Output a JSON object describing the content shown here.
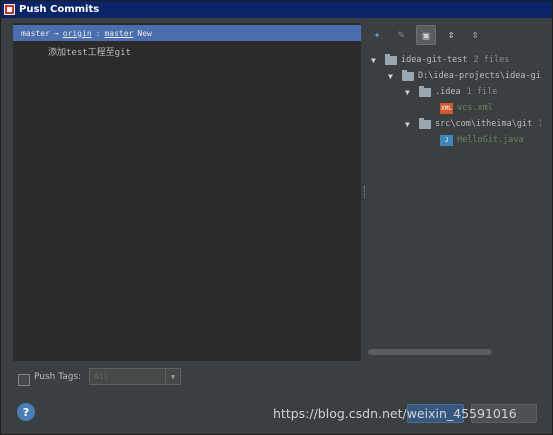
{
  "window": {
    "title": "Push Commits"
  },
  "commit_header": {
    "branch": "master",
    "arrow": "→",
    "remote": "origin",
    "colon": ":",
    "target": "master",
    "tag": "New"
  },
  "commit": {
    "message": "添加test工程至git"
  },
  "toolbar": {
    "icons": [
      "expand-all-icon",
      "edit-icon",
      "group-by-icon",
      "expand-icon",
      "collapse-icon"
    ]
  },
  "tree": {
    "project": {
      "name": "idea-git-test",
      "count": "2 files"
    },
    "path": {
      "name": "D:\\idea-projects\\idea-gi"
    },
    "idea_folder": {
      "name": ".idea",
      "count": "1 file"
    },
    "idea_file": {
      "name": "vcs.xml"
    },
    "src_folder": {
      "name": "src\\com\\itheima\\git",
      "count": "1"
    },
    "src_file": {
      "name": "HelloGit.java"
    }
  },
  "footer": {
    "push_tags_label": "Push Tags:",
    "tags_value": "All"
  },
  "watermark": "https://blog.csdn.net/weixin_45591016",
  "colors": {
    "selection": "#4b6eaf",
    "background": "#3c3f41",
    "editor": "#2b2b2b"
  }
}
